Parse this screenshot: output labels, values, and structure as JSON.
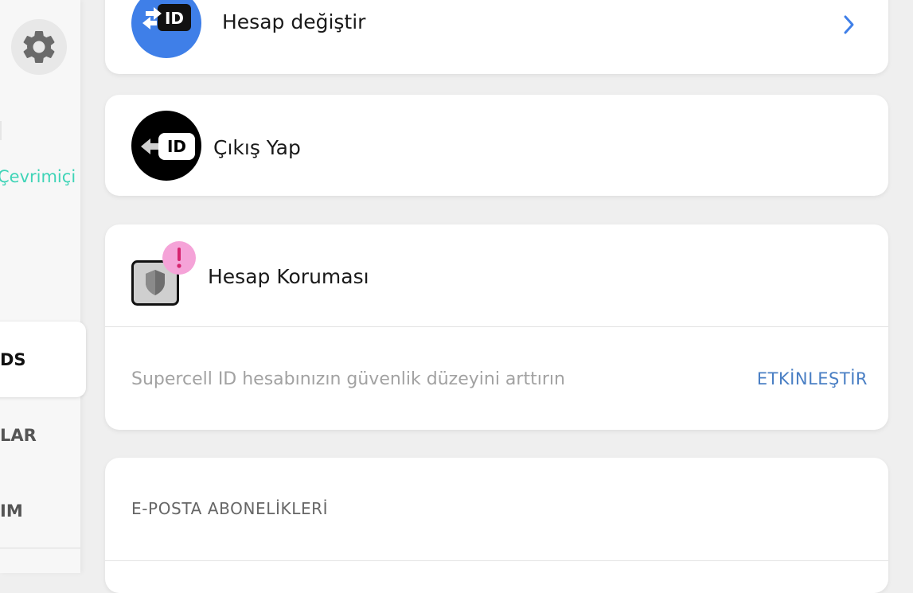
{
  "sidebar": {
    "status_text": "Çevrimiçi",
    "items": [
      {
        "label": "DS",
        "active": true
      },
      {
        "label": "LAR",
        "active": false
      },
      {
        "label": "IM",
        "active": false
      }
    ]
  },
  "account_rows": {
    "switch_account": {
      "label": "Hesap değiştir",
      "icon": "switch-id-icon"
    },
    "logout": {
      "label": "Çıkış Yap",
      "icon": "logout-id-icon"
    }
  },
  "account_protection": {
    "title": "Hesap Koruması",
    "badge_icon": "exclamation-icon",
    "description": "Supercell ID hesabınızın güvenlik düzeyini arttırın",
    "action_label": "ETKİNLEŞTİR"
  },
  "email_subscriptions": {
    "header": "E-POSTA ABONELİKLERİ"
  },
  "colors": {
    "accent_blue": "#4a7fc4",
    "switch_icon_bg": "#3f7fe8",
    "online_green": "#3fd4b7",
    "warning_pink": "#f59fd6"
  }
}
